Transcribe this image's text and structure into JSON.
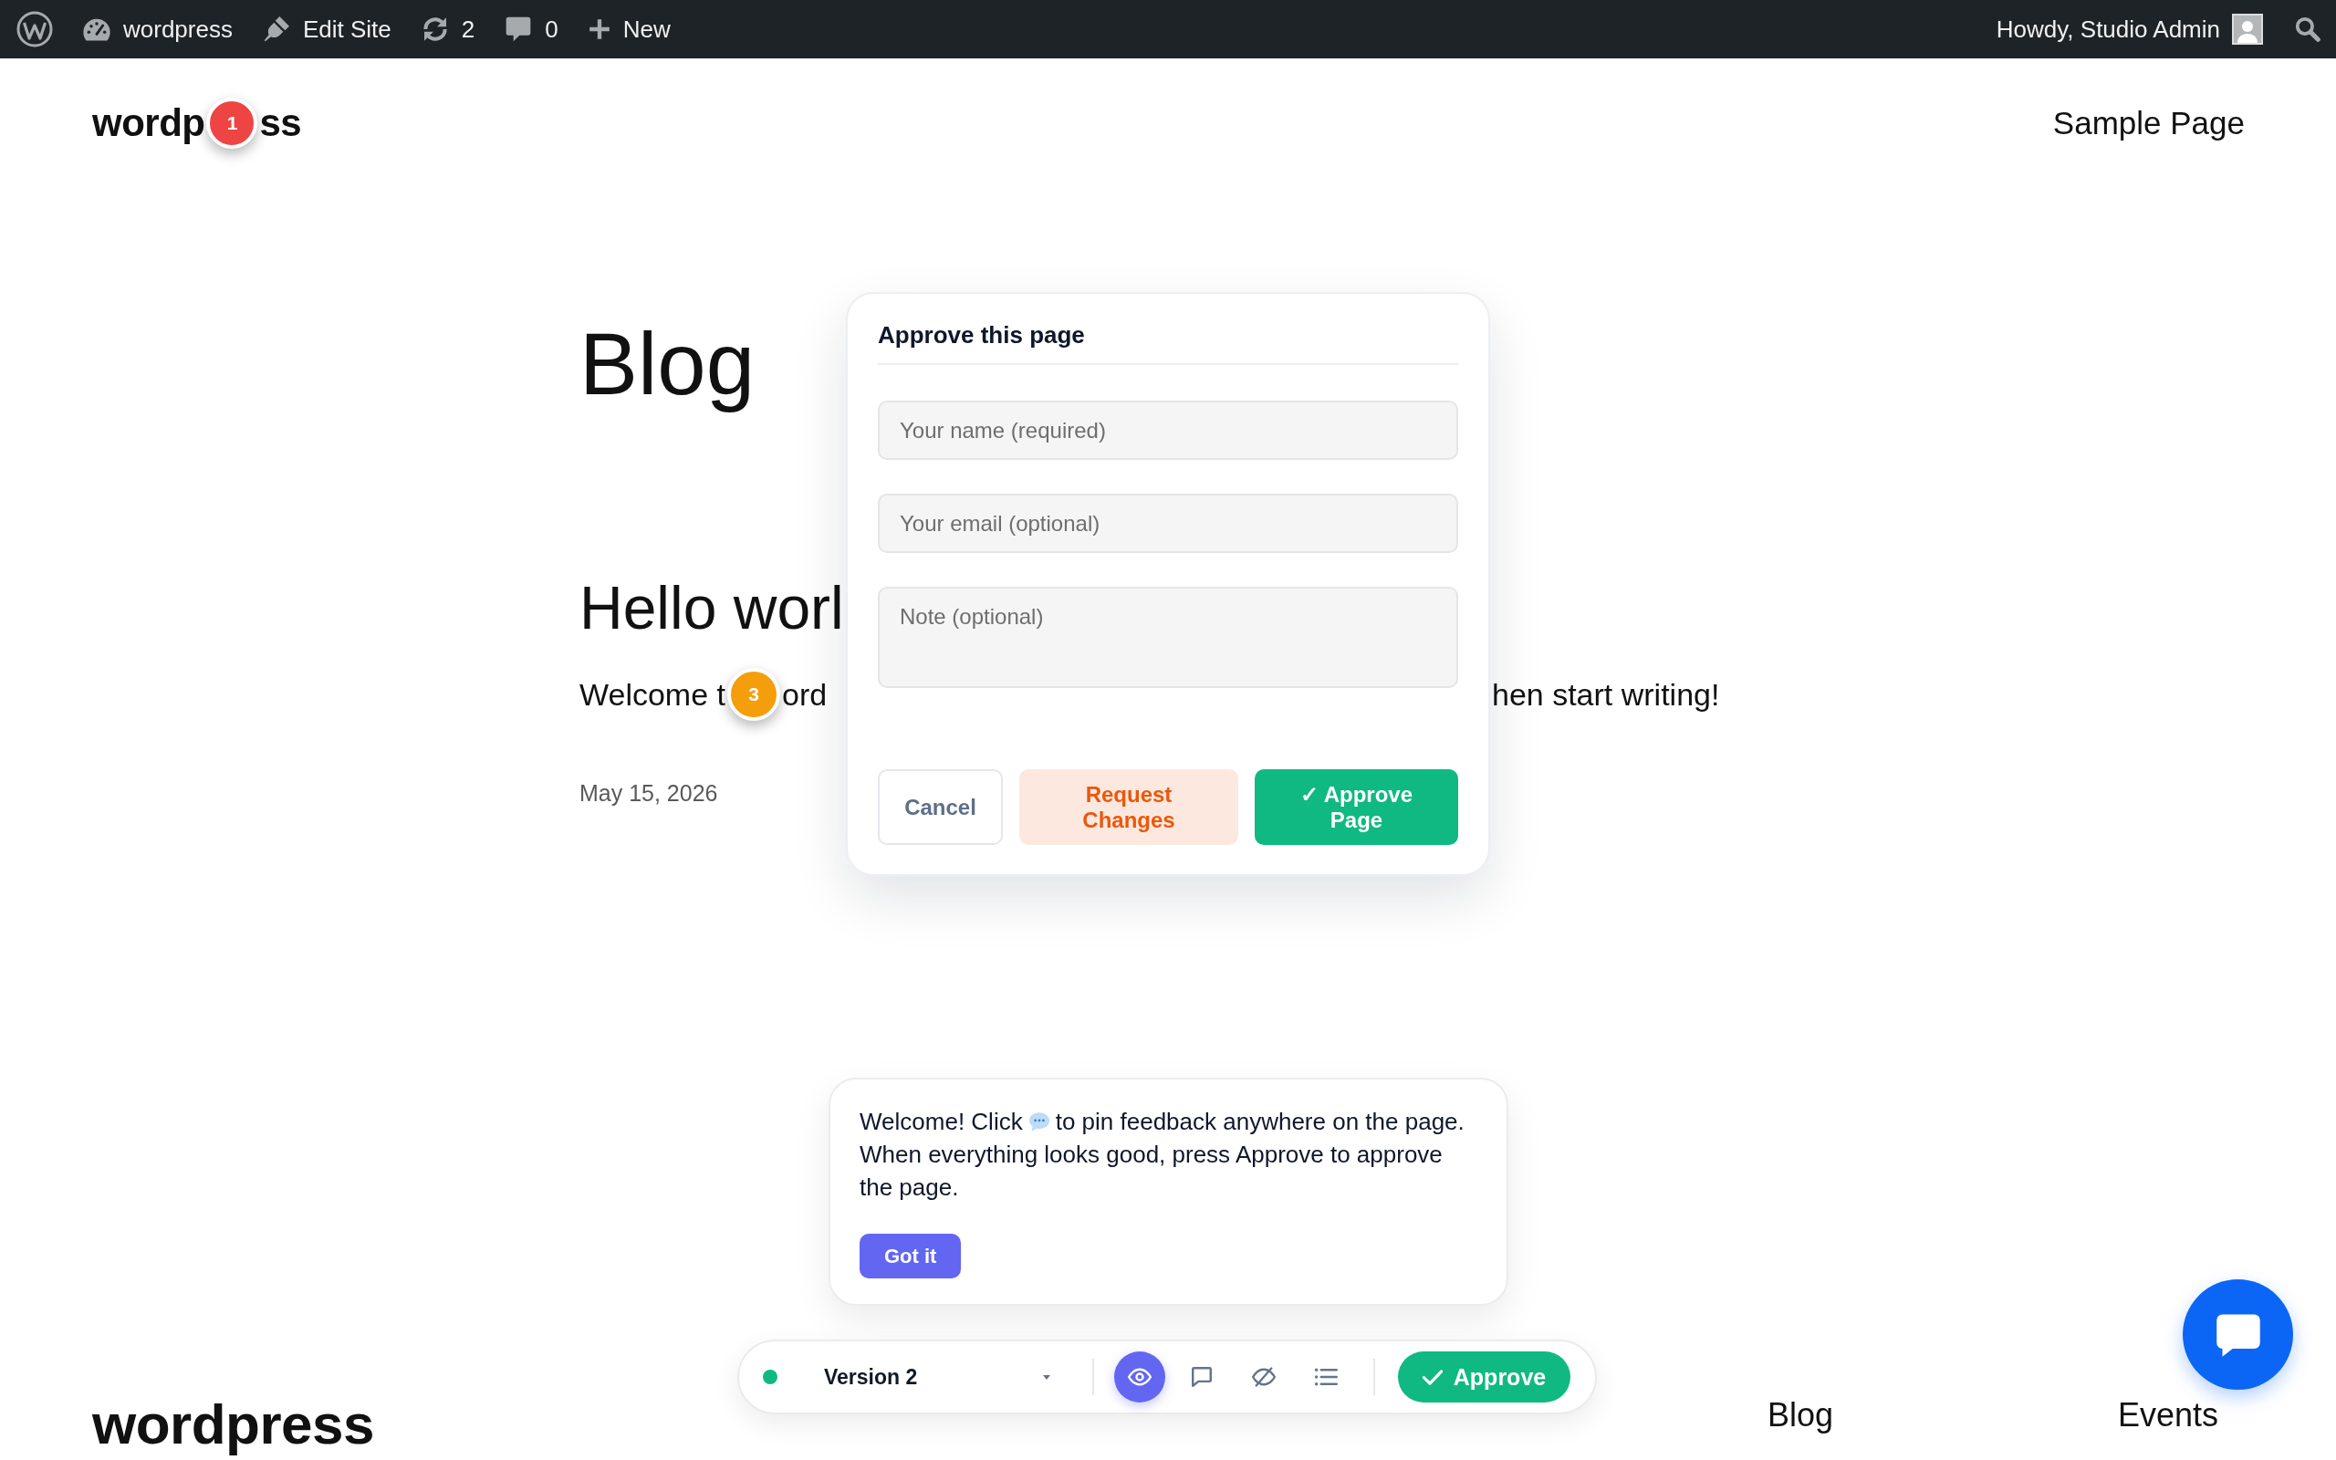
{
  "admin_bar": {
    "items": [
      {
        "kind": "wp-logo"
      },
      {
        "kind": "site",
        "label": "wordpress"
      },
      {
        "kind": "edit",
        "label": "Edit Site"
      },
      {
        "kind": "updates",
        "label": "2"
      },
      {
        "kind": "comments",
        "label": "0"
      },
      {
        "kind": "new",
        "label": "New"
      }
    ],
    "greeting": "Howdy, Studio Admin"
  },
  "site_header": {
    "title_parts": [
      "wordp",
      "ss"
    ],
    "pin": {
      "number": "1",
      "color": "#ef4444"
    },
    "nav": [
      "Sample Page"
    ]
  },
  "page_title": "Blog",
  "post": {
    "title": "Hello worl",
    "excerpt_parts": [
      "Welcome t",
      "ord",
      "hen start writing!"
    ],
    "pin": {
      "number": "3",
      "color": "#f59e0b"
    },
    "date": "May 15, 2026"
  },
  "approve_dialog": {
    "title": "Approve this page",
    "fields": [
      {
        "kind": "input",
        "placeholder": "Your name (required)"
      },
      {
        "kind": "input",
        "placeholder": "Your email (optional)"
      },
      {
        "kind": "textarea",
        "placeholder": "Note (optional)"
      }
    ],
    "buttons": [
      {
        "kind": "secondary",
        "label": "Cancel"
      },
      {
        "kind": "warning",
        "label": "Request Changes"
      },
      {
        "kind": "primary",
        "label": "✓ Approve Page"
      }
    ]
  },
  "welcome_tip": {
    "text_before": "Welcome! Click",
    "text_after": "to pin feedback anywhere on the page.",
    "text_second": "When everything looks good, press Approve to approve the page.",
    "button": "Got it"
  },
  "review_bar": {
    "version": "Version 2",
    "tools": [
      {
        "kind": "view",
        "selected": true
      },
      {
        "kind": "comment",
        "selected": false
      },
      {
        "kind": "hide",
        "selected": false
      },
      {
        "kind": "list",
        "selected": false
      }
    ],
    "approve": "Approve"
  },
  "footer": {
    "title": "wordpress",
    "nav": [
      "Blog",
      "Events"
    ]
  }
}
